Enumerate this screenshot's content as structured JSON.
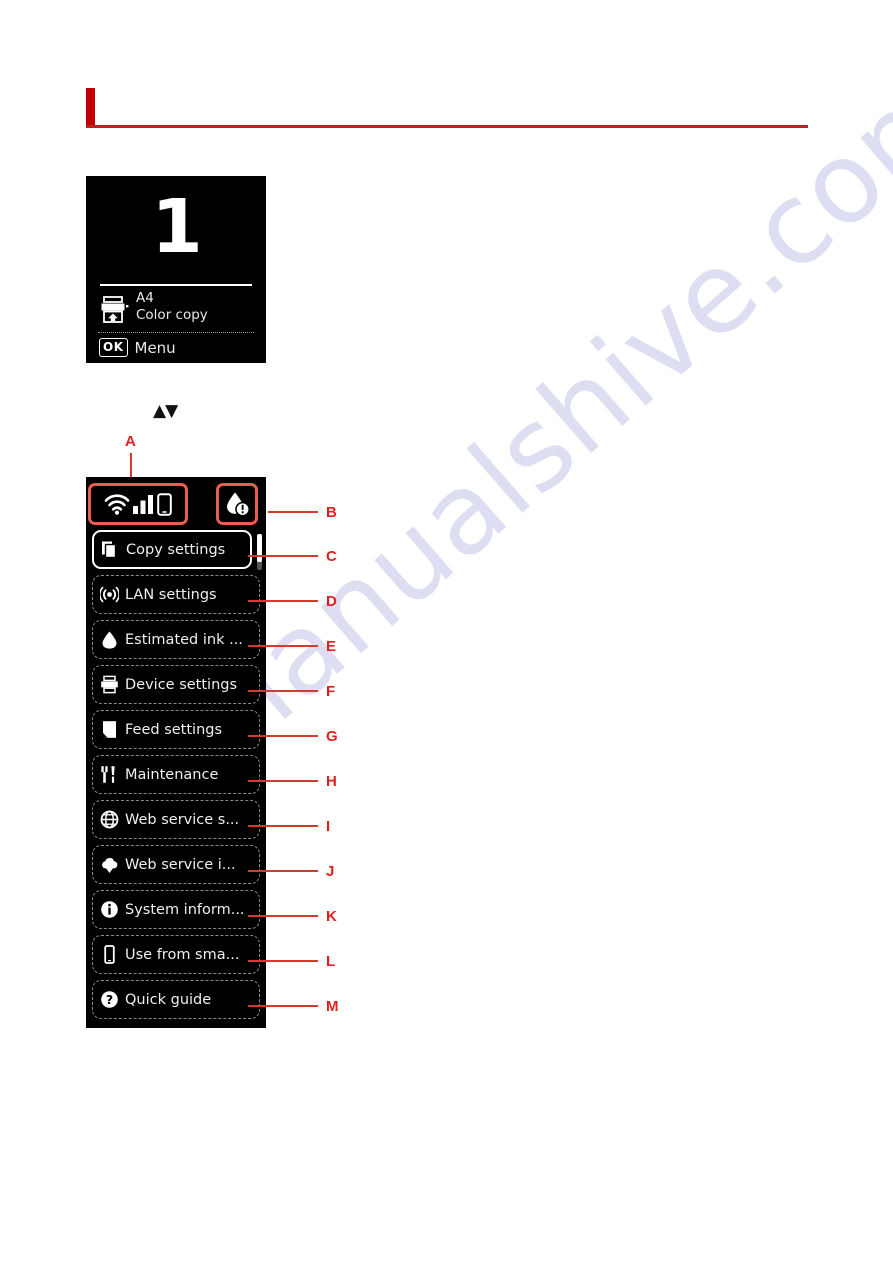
{
  "watermark": {
    "text": "manualshive.com"
  },
  "header": {
    "rule_color": "#bb2222",
    "tick_color": "#c00000"
  },
  "standby_screen": {
    "copies": "1",
    "start_icon": "start-diamond-icon",
    "printer_icon": "printer-feed-icon",
    "paper_size": "A4",
    "copy_mode": "Color copy",
    "ok_label": "OK",
    "menu_label": "Menu"
  },
  "navigation_hint": {
    "symbols": "▲▼"
  },
  "menu_screen": {
    "status_bar": {
      "wifi_icon": "wifi-icon",
      "signal_icon": "signal-bars-icon",
      "phone_icon": "smartphone-icon",
      "ink_icon": "ink-drop-alert-icon"
    },
    "scrollbar": {
      "position": "top"
    },
    "items": [
      {
        "label": "Copy settings",
        "icon": "copy-pages-icon",
        "selected": true
      },
      {
        "label": "LAN settings",
        "icon": "wireless-antenna-icon",
        "selected": false
      },
      {
        "label": "Estimated ink ...",
        "icon": "ink-drop-icon",
        "selected": false
      },
      {
        "label": "Device settings",
        "icon": "printer-icon",
        "selected": false
      },
      {
        "label": "Feed settings",
        "icon": "paper-sheet-icon",
        "selected": false
      },
      {
        "label": "Maintenance",
        "icon": "tools-icon",
        "selected": false
      },
      {
        "label": "Web service s...",
        "icon": "globe-icon",
        "selected": false
      },
      {
        "label": "Web service i...",
        "icon": "cloud-download-icon",
        "selected": false
      },
      {
        "label": "System inform...",
        "icon": "info-circle-icon",
        "selected": false
      },
      {
        "label": "Use from sma...",
        "icon": "smartphone-icon",
        "selected": false
      },
      {
        "label": "Quick guide",
        "icon": "question-circle-icon",
        "selected": false
      }
    ]
  },
  "callouts": {
    "accent_color": "#e02020",
    "a": "A",
    "b": "B",
    "c": "C",
    "d": "D",
    "e": "E",
    "f": "F",
    "g": "G",
    "h": "H",
    "i": "I",
    "j": "J",
    "k": "K",
    "l": "L",
    "m": "M"
  }
}
